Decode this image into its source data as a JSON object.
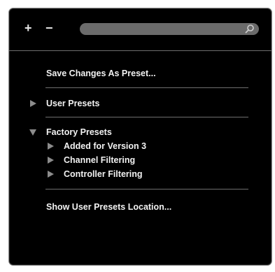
{
  "toolbar": {
    "add_label": "+",
    "remove_label": "−",
    "search_value": ""
  },
  "menu": {
    "save_changes": "Save Changes As Preset...",
    "user_presets": "User Presets",
    "factory_presets": "Factory Presets",
    "factory_children": [
      "Added for Version 3",
      "Channel Filtering",
      "Controller Filtering"
    ],
    "show_location": "Show User Presets Location..."
  },
  "icons": {
    "search": "search-icon",
    "collapsed": "triangle-right-icon",
    "expanded": "triangle-down-icon"
  },
  "colors": {
    "panel_bg": "#000000",
    "text": "#f2f2f2",
    "arrow": "#8c8c8c",
    "search_field": "#6b6b6b",
    "separator": "#6f6f6f"
  }
}
